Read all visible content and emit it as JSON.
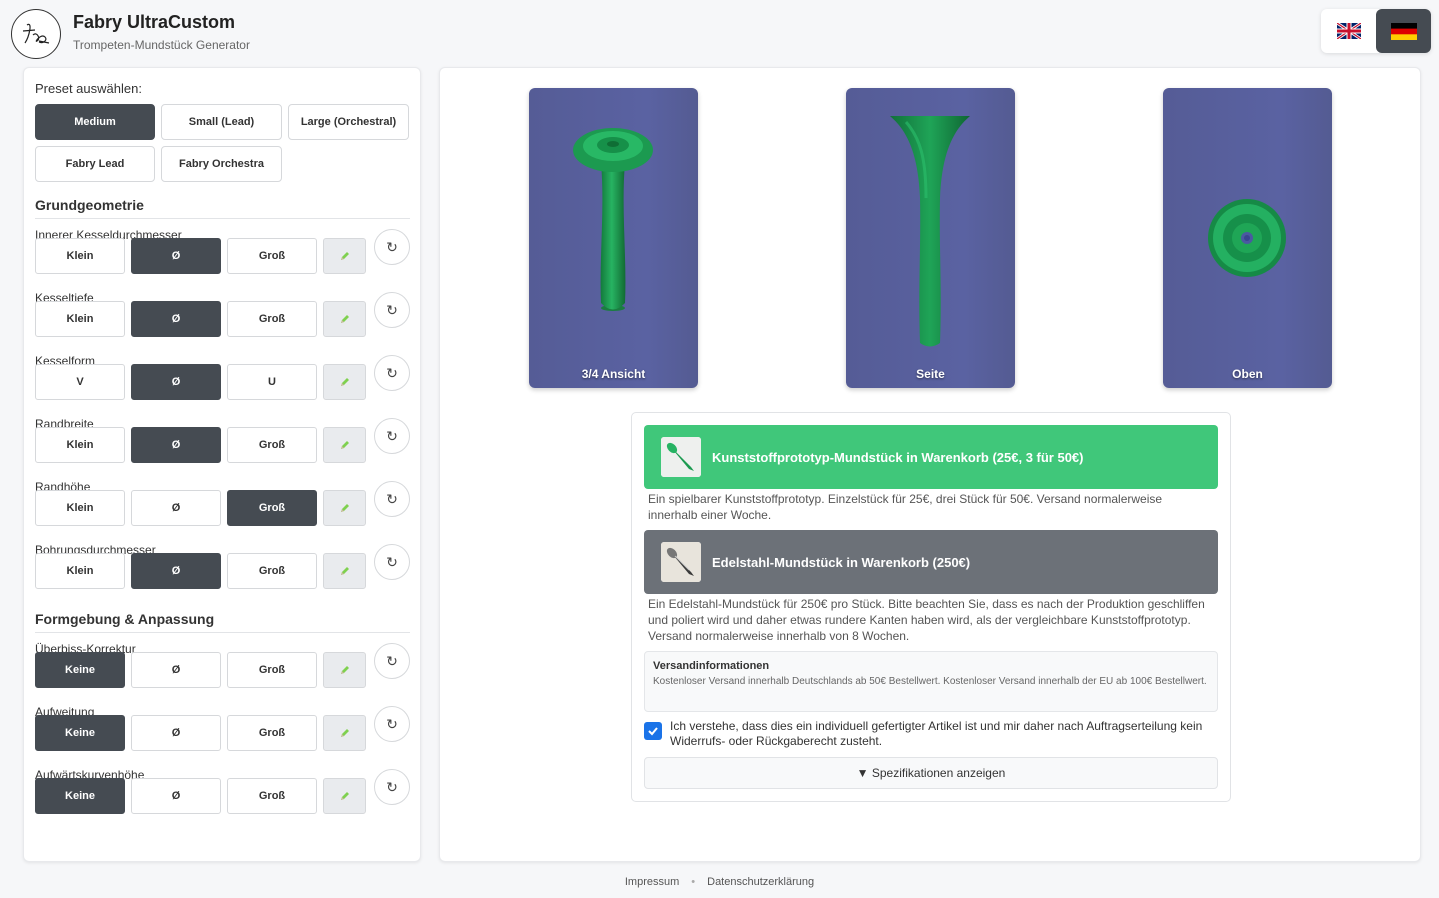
{
  "header": {
    "title": "Fabry UltraCustom",
    "subtitle": "Trompeten-Mundstück Generator",
    "languages": [
      {
        "name": "uk-flag-icon",
        "active": false
      },
      {
        "name": "de-flag-icon",
        "active": true
      }
    ]
  },
  "presets": {
    "label": "Preset auswählen:",
    "items": [
      "Medium",
      "Small (Lead)",
      "Large (Orchestral)",
      "Fabry Lead",
      "Fabry Orchestra"
    ],
    "active": "Medium"
  },
  "sections": {
    "basic": "Grundgeometrie",
    "shaping": "Formgebung & Anpassung"
  },
  "params": [
    {
      "label": "Innerer Kesseldurchmesser",
      "options": [
        "Klein",
        "Ø",
        "Groß"
      ],
      "active": 1
    },
    {
      "label": "Kesseltiefe",
      "options": [
        "Klein",
        "Ø",
        "Groß"
      ],
      "active": 1
    },
    {
      "label": "Kesselform",
      "options": [
        "V",
        "Ø",
        "U"
      ],
      "active": 1
    },
    {
      "label": "Randbreite",
      "options": [
        "Klein",
        "Ø",
        "Groß"
      ],
      "active": 1
    },
    {
      "label": "Randhöhe",
      "options": [
        "Klein",
        "Ø",
        "Groß"
      ],
      "active": 2
    },
    {
      "label": "Bohrungsdurchmesser",
      "options": [
        "Klein",
        "Ø",
        "Groß"
      ],
      "active": 1
    },
    {
      "label": "Überbiss-Korrektur",
      "options": [
        "Keine",
        "Ø",
        "Groß"
      ],
      "active": 0
    },
    {
      "label": "Aufweitung",
      "options": [
        "Keine",
        "Ø",
        "Groß"
      ],
      "active": 0
    },
    {
      "label": "Aufwärtskurvenhöhe",
      "options": [
        "Keine",
        "Ø",
        "Groß"
      ],
      "active": 0
    }
  ],
  "views": [
    {
      "label": "3/4 Ansicht"
    },
    {
      "label": "Seite"
    },
    {
      "label": "Oben"
    }
  ],
  "shop": {
    "plastic_cta": "Kunststoffprototyp-Mundstück in Warenkorb (25€, 3 für 50€)",
    "plastic_desc": "Ein spielbarer Kunststoffprototyp. Einzelstück für 25€, drei Stück für 50€. Versand normalerweise innerhalb einer Woche.",
    "steel_cta": "Edelstahl-Mundstück in Warenkorb (250€)",
    "steel_desc": "Ein Edelstahl-Mundstück für 250€ pro Stück. Bitte beachten Sie, dass es nach der Produktion geschliffen und poliert wird und daher etwas rundere Kanten haben wird, als der vergleichbare Kunststoffprototyp. Versand normalerweise innerhalb von 8 Wochen.",
    "shipping_title": "Versandinformationen",
    "shipping_text": "Kostenloser Versand innerhalb Deutschlands ab 50€ Bestellwert. Kostenloser Versand innerhalb der EU ab 100€ Bestellwert.",
    "consent": "Ich verstehe, dass dies ein individuell gefertigter Artikel ist und mir daher nach Auftragserteilung kein Widerrufs- oder Rückgaberecht zusteht.",
    "consent_checked": true,
    "specs_toggle": "▼ Spezifikationen anzeigen"
  },
  "footer": {
    "imprint": "Impressum",
    "privacy": "Datenschutzerklärung",
    "separator": "•"
  },
  "colors": {
    "accent_dark": "#454b52",
    "plastic_green": "#40c77a",
    "steel_gray": "#6c7178",
    "viewer_bg": "#5a62a2",
    "model_green": "#1e9a52"
  }
}
